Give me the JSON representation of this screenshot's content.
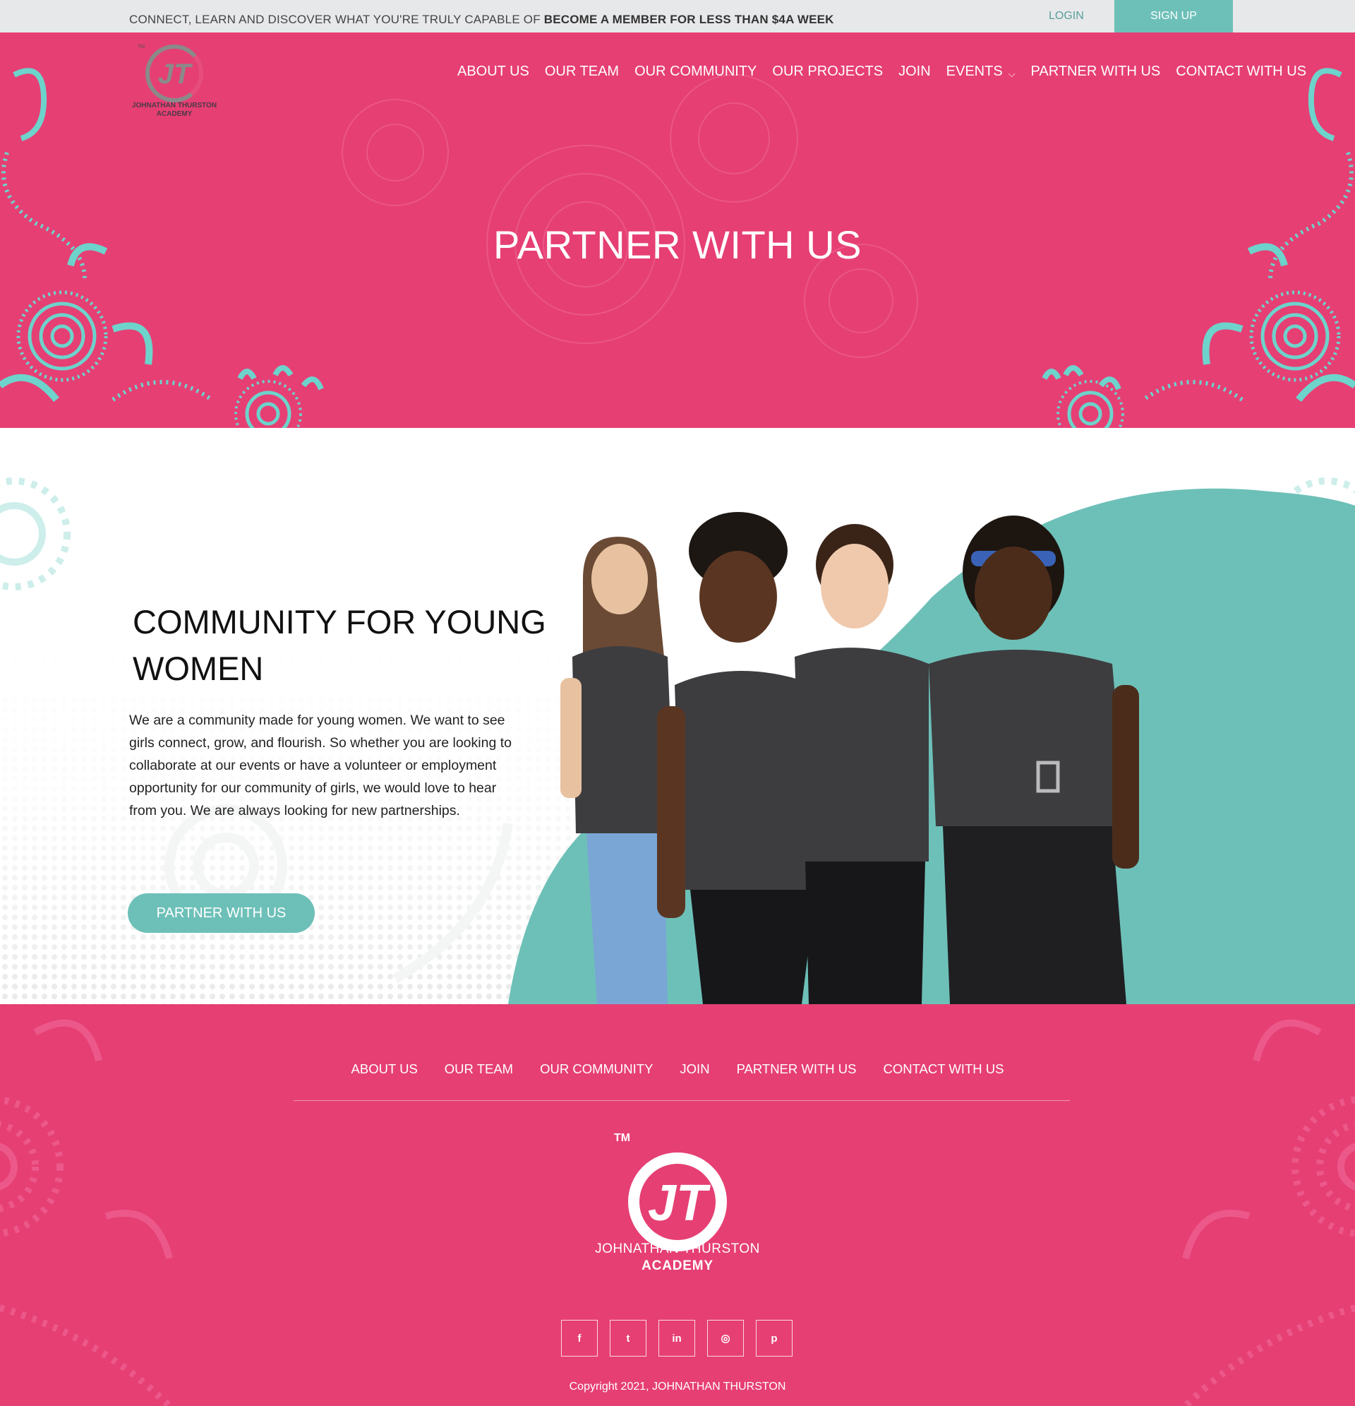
{
  "colors": {
    "brand_pink": "#e63f74",
    "brand_teal": "#6dc0b8",
    "topbar_bg": "#e7e8ea"
  },
  "topbar": {
    "tagline": "CONNECT, LEARN AND DISCOVER WHAT YOU'RE TRULY CAPABLE OF",
    "tagline_bold": "BECOME A MEMBER FOR LESS THAN $4A WEEK",
    "login_label": "LOGIN",
    "signup_label": "SIGN UP"
  },
  "brand": {
    "tm": "TM",
    "monogram": "JT",
    "name_line1": "JOHNATHAN THURSTON",
    "name_line2": "ACADEMY"
  },
  "nav": {
    "items": [
      {
        "label": "ABOUT US"
      },
      {
        "label": "OUR TEAM"
      },
      {
        "label": "OUR COMMUNITY"
      },
      {
        "label": "OUR PROJECTS"
      },
      {
        "label": "JOIN"
      },
      {
        "label": "EVENTS",
        "chevron": "⌵"
      },
      {
        "label": "PARTNER WITH US"
      },
      {
        "label": "CONTACT WITH US"
      }
    ]
  },
  "hero": {
    "title": "PARTNER WITH US"
  },
  "community": {
    "title": "COMMUNITY FOR YOUNG WOMEN",
    "body": "We are a community made for young women. We want to see girls connect, grow, and flourish. So whether you are looking to collaborate at our events or have a volunteer or employment opportunity for our community of girls, we would love to hear from you. We are always looking for new partnerships.",
    "button_label": "PARTNER WITH US"
  },
  "footer": {
    "nav": [
      {
        "label": "ABOUT US"
      },
      {
        "label": "OUR TEAM"
      },
      {
        "label": "OUR COMMUNITY"
      },
      {
        "label": "JOIN"
      },
      {
        "label": "PARTNER WITH US"
      },
      {
        "label": "CONTACT WITH US"
      }
    ],
    "social": [
      {
        "icon": "facebook-icon",
        "glyph": "f"
      },
      {
        "icon": "twitter-icon",
        "glyph": "t"
      },
      {
        "icon": "linkedin-icon",
        "glyph": "in"
      },
      {
        "icon": "instagram-icon",
        "glyph": "◎"
      },
      {
        "icon": "pinterest-icon",
        "glyph": "p"
      }
    ],
    "copyright": "Copyright 2021, JOHNATHAN THURSTON"
  }
}
